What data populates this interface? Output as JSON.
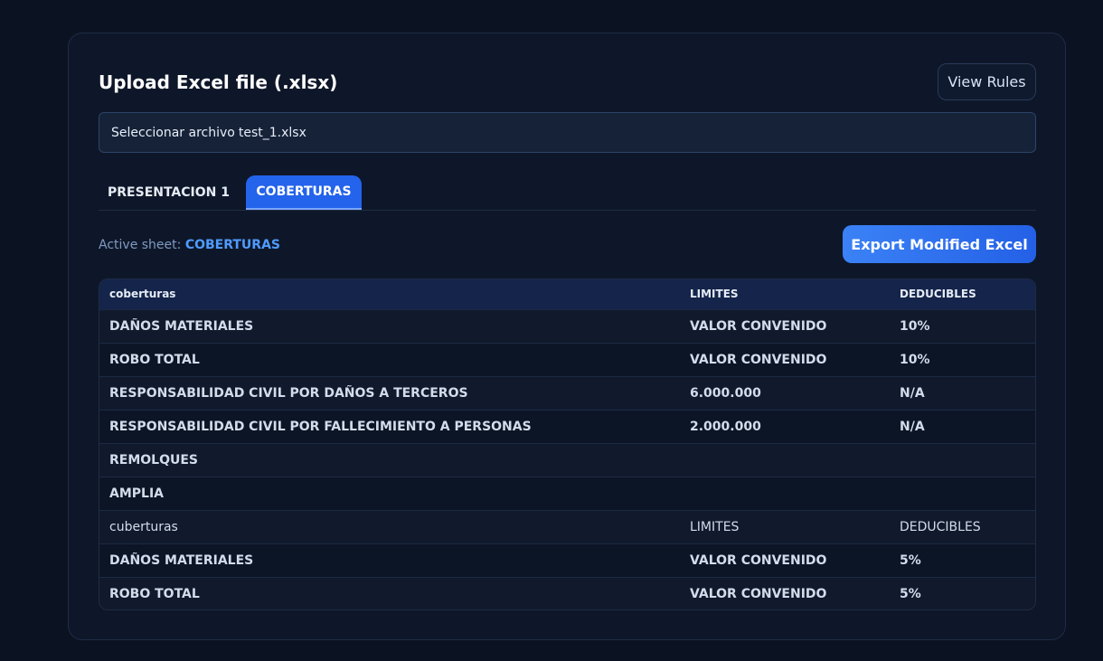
{
  "upload": {
    "title": "Upload Excel file (.xlsx)",
    "view_rules_label": "View Rules",
    "file_button_label": "Seleccionar archivo",
    "file_name": "test_1.xlsx"
  },
  "tabs": [
    {
      "label": "PRESENTACION 1",
      "active": false
    },
    {
      "label": "COBERTURAS",
      "active": true
    }
  ],
  "sheet": {
    "active_label": "Active sheet:",
    "active_name": "COBERTURAS",
    "export_label": "Export Modified Excel"
  },
  "table": {
    "headers": [
      "coberturas",
      "LIMITES",
      "DEDUCIBLES"
    ],
    "rows": [
      [
        "DAÑOS MATERIALES",
        "VALOR CONVENIDO",
        "10%"
      ],
      [
        "ROBO TOTAL",
        "VALOR CONVENIDO",
        "10%"
      ],
      [
        "RESPONSABILIDAD CIVIL POR DAÑOS A TERCEROS",
        "6.000.000",
        "N/A"
      ],
      [
        "RESPONSABILIDAD CIVIL POR FALLECIMIENTO A PERSONAS",
        "2.000.000",
        "N/A"
      ],
      [
        "REMOLQUES",
        "",
        ""
      ],
      [
        "AMPLIA",
        "",
        ""
      ],
      [
        "cuberturas",
        "LIMITES",
        "DEDUCIBLES"
      ],
      [
        "DAÑOS MATERIALES",
        "VALOR CONVENIDO",
        "5%"
      ],
      [
        "ROBO TOTAL",
        "VALOR CONVENIDO",
        "5%"
      ]
    ]
  },
  "colors": {
    "background": "#0b1222",
    "card": "#0e1729",
    "accent": "#2463eb",
    "active_sheet_name": "#4f9bff"
  }
}
